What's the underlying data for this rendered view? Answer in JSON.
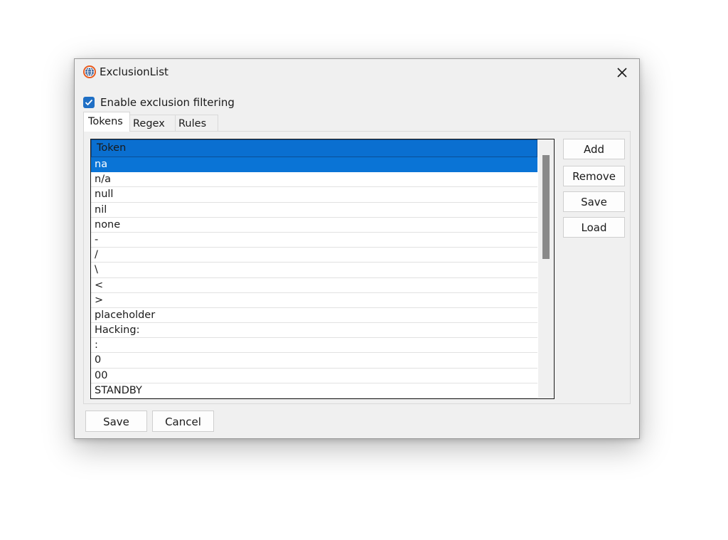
{
  "window": {
    "title": "ExclusionList",
    "close_icon": "close-icon"
  },
  "filter": {
    "checkbox_label": "Enable exclusion filtering",
    "checked": true
  },
  "tabs": [
    {
      "label": "Tokens",
      "active": true
    },
    {
      "label": "Regex",
      "active": false
    },
    {
      "label": "Rules",
      "active": false
    }
  ],
  "list": {
    "column_header": "Token",
    "rows": [
      "na",
      "n/a",
      "null",
      "nil",
      "none",
      "-",
      "/",
      "\\",
      "<",
      ">",
      "placeholder",
      "Hacking:",
      ":",
      "0",
      "00",
      "STANDBY"
    ],
    "selected_index": 0
  },
  "side_buttons": {
    "add": "Add",
    "remove": "Remove",
    "save": "Save",
    "load": "Load"
  },
  "footer_buttons": {
    "save": "Save",
    "cancel": "Cancel"
  },
  "colors": {
    "accent": "#0a74d6",
    "checkbox": "#1f6fc5"
  }
}
